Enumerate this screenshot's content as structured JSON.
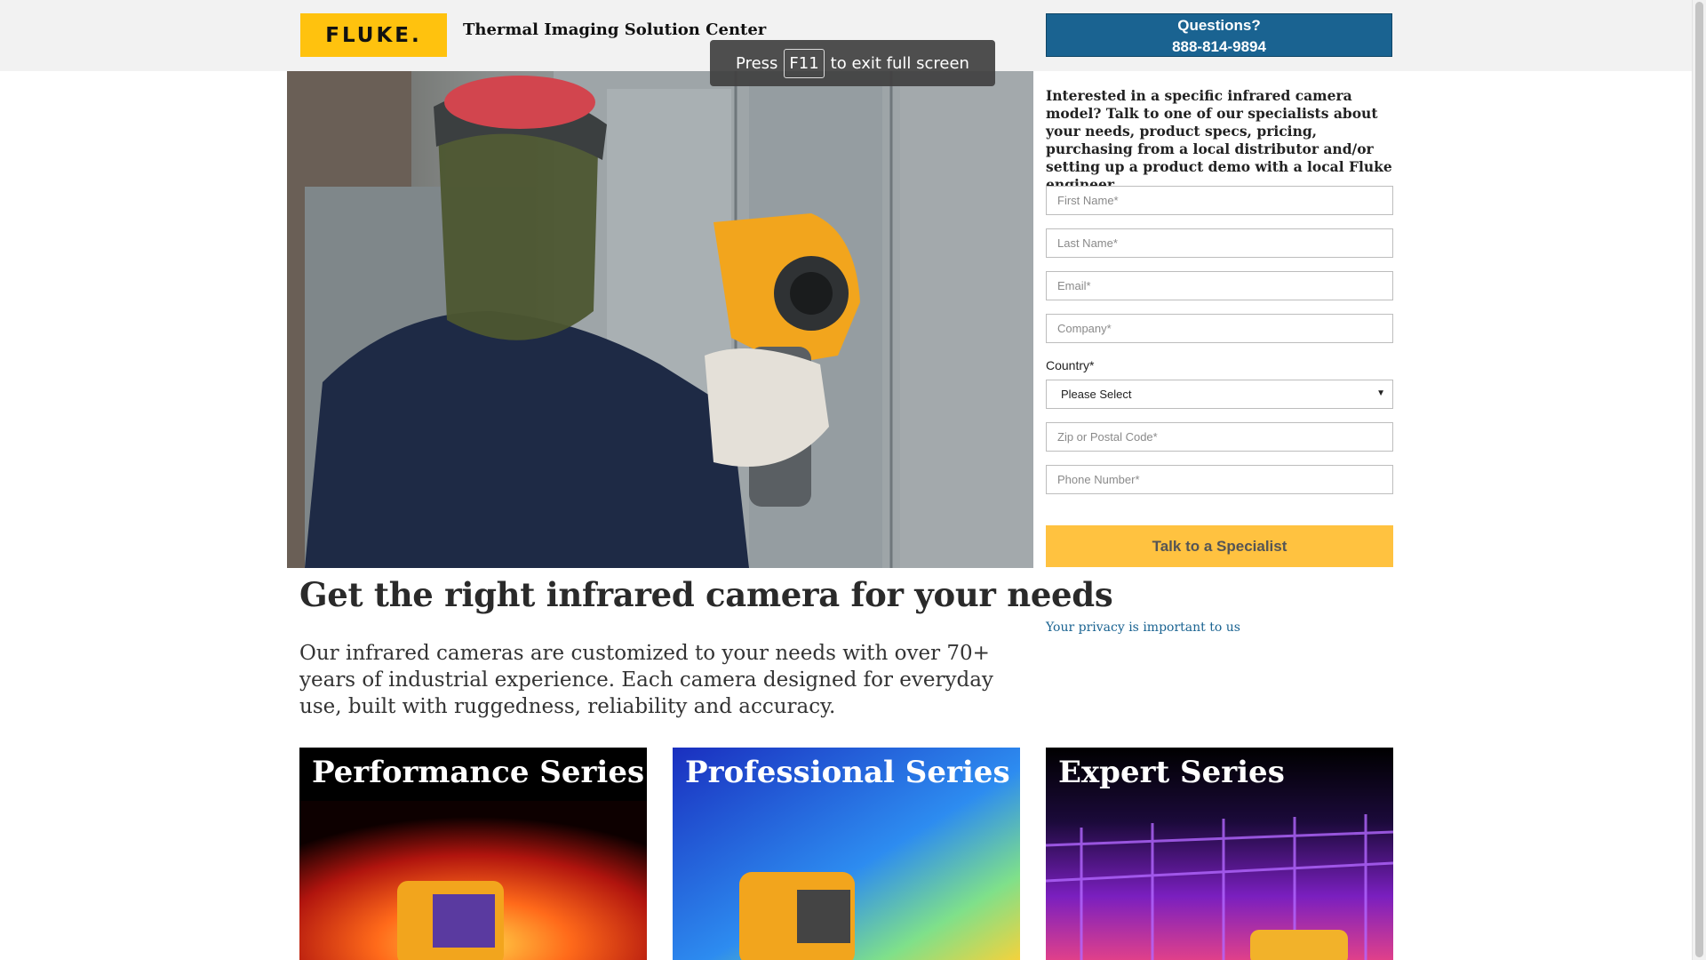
{
  "header": {
    "logo_text": "FLUKE.",
    "site_title": "Thermal Imaging Solution Center",
    "questions_label": "Questions?",
    "phone": "888-814-9894"
  },
  "fullscreen_notice": {
    "press": "Press",
    "key": "F11",
    "rest": "to exit full screen"
  },
  "form": {
    "intro": "Interested in a specific infrared camera model? Talk to one of our specialists about your needs, product specs, pricing, purchasing from a local distributor and/or setting up a product demo with a local Fluke engineer.",
    "first_name_placeholder": "First Name*",
    "last_name_placeholder": "Last Name*",
    "email_placeholder": "Email*",
    "company_placeholder": "Company*",
    "country_label": "Country*",
    "country_value": "Please Select",
    "zip_placeholder": "Zip or Postal Code*",
    "phone_placeholder": "Phone Number*",
    "submit_label": "Talk to a Specialist",
    "privacy_link": "Your privacy is important to us"
  },
  "main": {
    "headline": "Get the right infrared camera for your needs",
    "lead": "Our infrared cameras are customized to your needs with over 70+ years of industrial experience. Each camera designed for everyday use, built with ruggedness, reliability and accuracy."
  },
  "series": [
    {
      "title": "Performance Series"
    },
    {
      "title": "Professional Series"
    },
    {
      "title": "Expert Series"
    }
  ],
  "colors": {
    "brand_yellow": "#ffc20e",
    "brand_blue": "#1a6391",
    "cta_yellow": "#ffc240"
  },
  "icons": {
    "select_caret": "caret-down-icon"
  }
}
